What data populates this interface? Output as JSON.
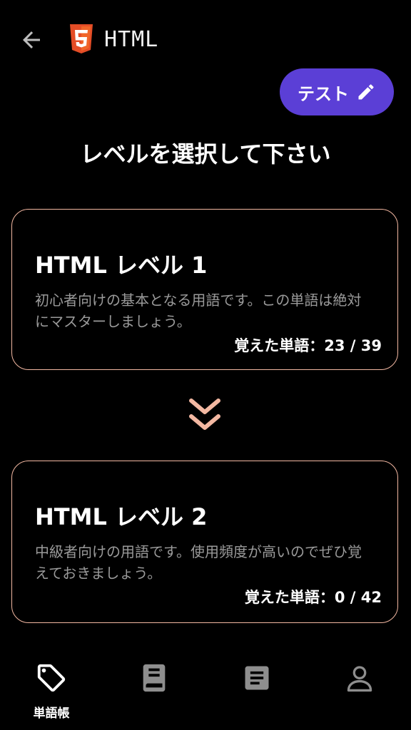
{
  "header": {
    "title": "HTML",
    "back_icon": "arrow-left-icon",
    "logo_icon": "html5-logo-icon",
    "logo_color": "#e44d26"
  },
  "test_button": {
    "label": "テスト",
    "icon": "pencil-icon",
    "color": "#5b3fd6"
  },
  "page_title": "レベルを選択して下さい",
  "levels": [
    {
      "title": "HTML レベル 1",
      "description": "初心者向けの基本となる用語です。この単語は絶対にマスターしましょう。",
      "progress": "覚えた単語：23 / 39"
    },
    {
      "title": "HTML レベル 2",
      "description": "中級者向けの用語です。使用頻度が高いのでぜひ覚えておきましょう。",
      "progress": "覚えた単語：0 / 42"
    }
  ],
  "accent_color": "#f3b8a2",
  "nav": [
    {
      "label": "単語帳",
      "icon": "tag-icon",
      "active": true
    },
    {
      "label": "",
      "icon": "book-icon",
      "active": false
    },
    {
      "label": "",
      "icon": "note-icon",
      "active": false
    },
    {
      "label": "",
      "icon": "person-icon",
      "active": false
    }
  ]
}
